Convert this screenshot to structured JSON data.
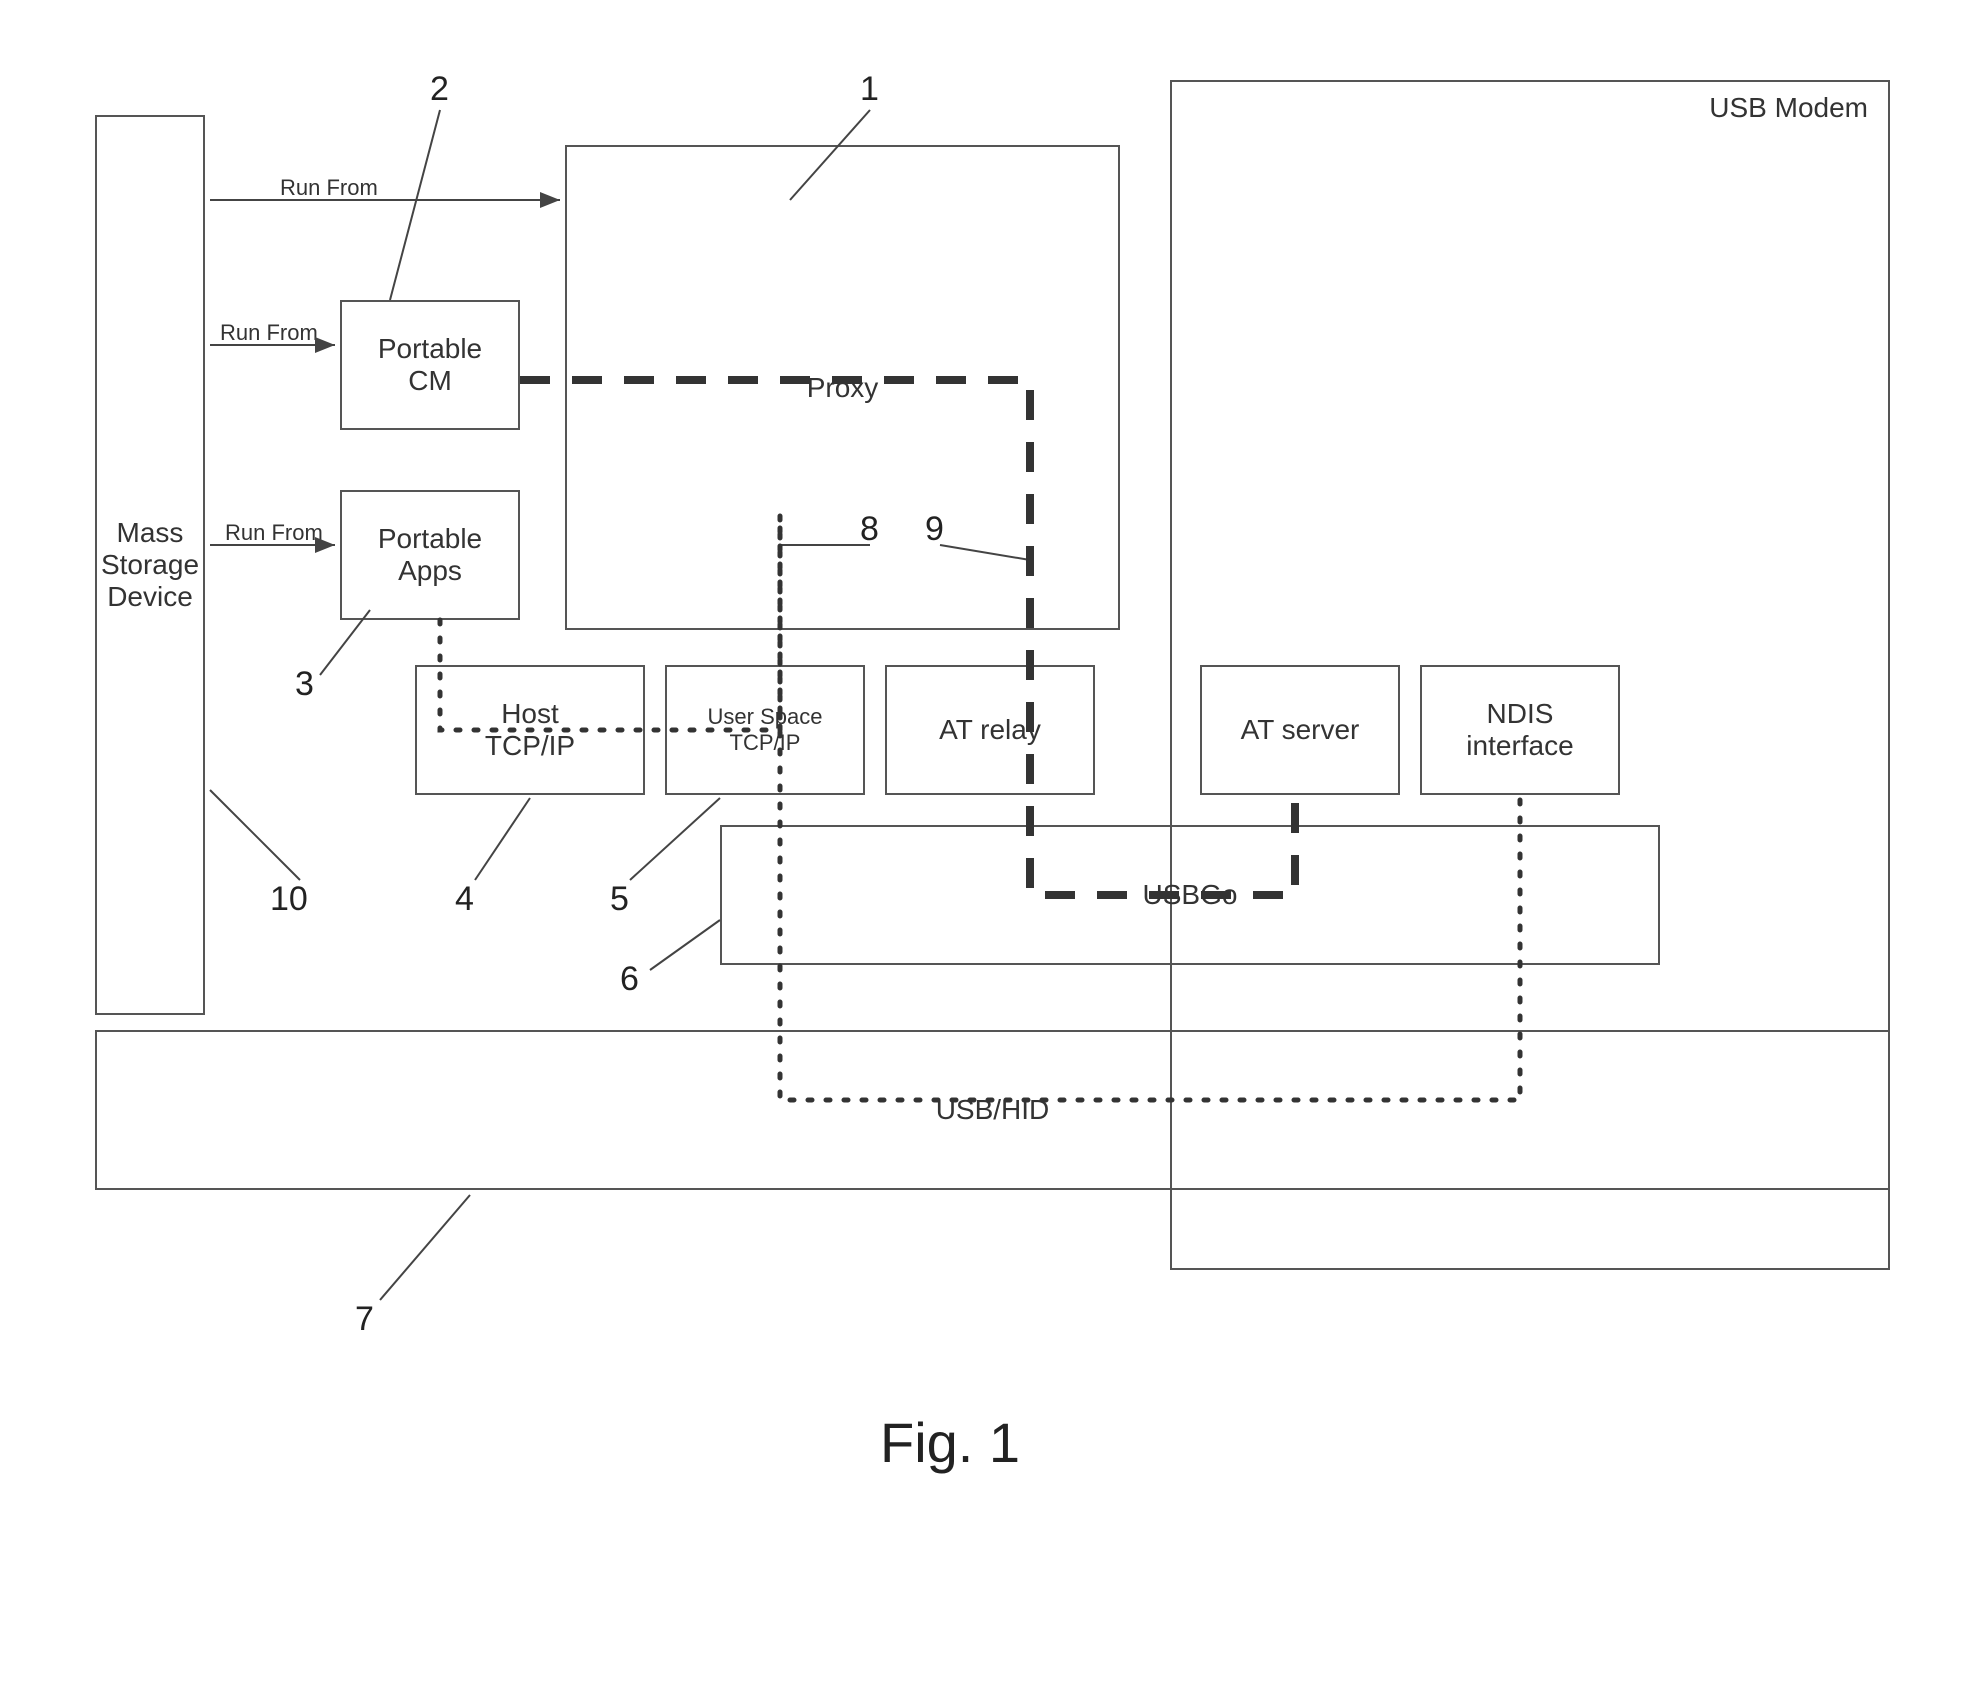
{
  "title": "Fig. 1",
  "boxes": {
    "mass_storage": "Mass\nStorage\nDevice",
    "portable_cm": "Portable\nCM",
    "portable_apps": "Portable\nApps",
    "proxy": "Proxy",
    "host_tcpip": "Host\nTCP/IP",
    "user_tcpip": "User Space\nTCP/IP",
    "at_relay": "AT relay",
    "at_server": "AT server",
    "ndis": "NDIS\ninterface",
    "usbgo": "USBGo",
    "usb_hid": "USB/HID",
    "usb_modem": "USB Modem"
  },
  "labels": {
    "run_from_1": "Run From",
    "run_from_2": "Run From",
    "run_from_3": "Run From"
  },
  "callouts": {
    "1": "1",
    "2": "2",
    "3": "3",
    "4": "4",
    "5": "5",
    "6": "6",
    "7": "7",
    "8": "8",
    "9": "9",
    "10": "10"
  }
}
